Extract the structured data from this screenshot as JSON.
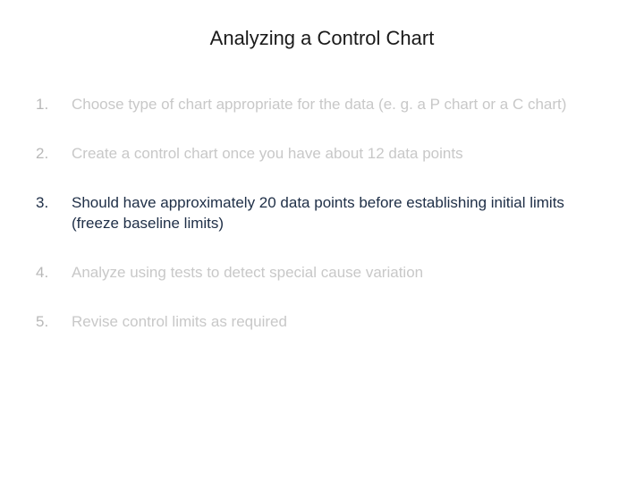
{
  "title": "Analyzing a Control Chart",
  "items": [
    {
      "num": "1.",
      "text": "Choose type of chart appropriate for the data (e. g. a P chart or a C chart)"
    },
    {
      "num": "2.",
      "text": "Create a control chart once you have about 12 data points"
    },
    {
      "num": "3.",
      "text": "Should have approximately 20 data points before establishing initial limits (freeze baseline limits)"
    },
    {
      "num": "4.",
      "text": "Analyze using tests to detect special cause variation"
    },
    {
      "num": "5.",
      "text": "Revise control limits as required"
    }
  ]
}
